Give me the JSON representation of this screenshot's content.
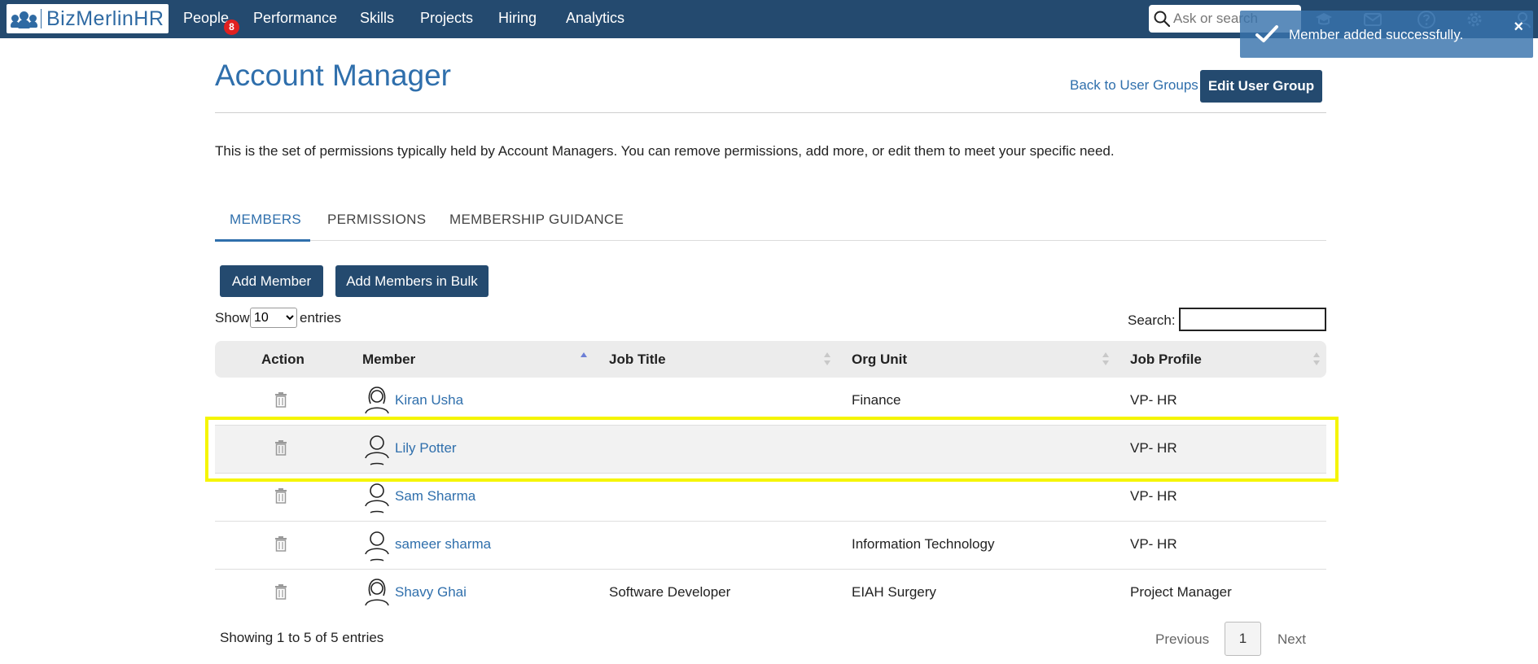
{
  "brand": {
    "name": "BizMerlinHR"
  },
  "nav": {
    "items": [
      {
        "label": "People"
      },
      {
        "label": "Performance"
      },
      {
        "label": "Skills"
      },
      {
        "label": "Projects"
      },
      {
        "label": "Hiring"
      },
      {
        "label": "Analytics"
      }
    ],
    "people_badge": "8",
    "search_placeholder": "Ask or search"
  },
  "toast": {
    "message": "Member added successfully.",
    "close": "×"
  },
  "page": {
    "title": "Account Manager",
    "back_link": "Back to User Groups",
    "edit_button": "Edit User Group",
    "description": "This is the set of permissions typically held by Account Managers. You can remove permissions, add more, or edit them to meet your specific need."
  },
  "tabs": [
    {
      "label": "MEMBERS",
      "active": true
    },
    {
      "label": "PERMISSIONS",
      "active": false
    },
    {
      "label": "MEMBERSHIP GUIDANCE",
      "active": false
    }
  ],
  "actions": {
    "add_member": "Add Member",
    "add_bulk": "Add Members in Bulk"
  },
  "table_controls": {
    "show_label": "Show",
    "entries_value": "10",
    "entries_label": "entries",
    "search_label": "Search:"
  },
  "table": {
    "columns": [
      "Action",
      "Member",
      "Job Title",
      "Org Unit",
      "Job Profile"
    ],
    "rows": [
      {
        "member": "Kiran Usha",
        "job_title": "",
        "org_unit": "Finance",
        "job_profile": "VP- HR",
        "avatar": "female"
      },
      {
        "member": "Lily Potter",
        "job_title": "",
        "org_unit": "",
        "job_profile": "VP- HR",
        "avatar": "generic"
      },
      {
        "member": "Sam Sharma",
        "job_title": "",
        "org_unit": "",
        "job_profile": "VP- HR",
        "avatar": "generic"
      },
      {
        "member": "sameer sharma",
        "job_title": "",
        "org_unit": "Information Technology",
        "job_profile": "VP- HR",
        "avatar": "generic"
      },
      {
        "member": "Shavy Ghai",
        "job_title": "Software Developer",
        "org_unit": "EIAH Surgery",
        "job_profile": "Project Manager",
        "avatar": "female"
      }
    ]
  },
  "pagination": {
    "info": "Showing 1 to 5 of 5 entries",
    "previous": "Previous",
    "page": "1",
    "next": "Next"
  },
  "colors": {
    "nav_bg": "#244a6f",
    "link": "#2f6fac",
    "highlight": "#f5f500"
  }
}
